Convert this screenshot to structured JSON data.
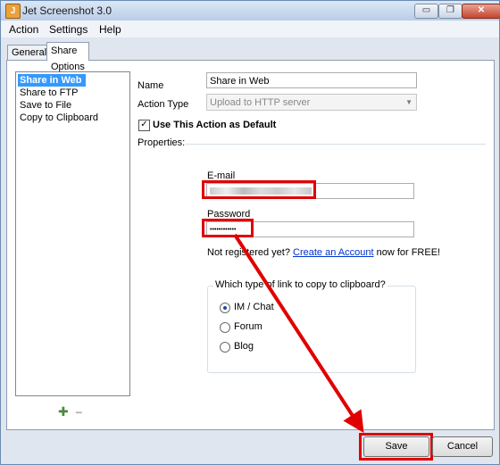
{
  "window": {
    "title": "Jet Screenshot 3.0",
    "minimize_glyph": "▭",
    "restore_glyph": "❐",
    "close_glyph": "✕"
  },
  "menu": {
    "items": [
      {
        "label": "Action"
      },
      {
        "label": "Settings"
      },
      {
        "label": "Help"
      }
    ]
  },
  "tabs": [
    {
      "label": "General"
    },
    {
      "label": "Share Options"
    }
  ],
  "actions": {
    "items": [
      {
        "label": "Share in Web"
      },
      {
        "label": "Share to FTP"
      },
      {
        "label": "Save to File"
      },
      {
        "label": "Copy to Clipboard"
      }
    ],
    "add_glyph": "✚",
    "remove_glyph": "━"
  },
  "form": {
    "name_label": "Name",
    "name_value": "Share in Web",
    "action_type_label": "Action Type",
    "action_type_value": "Upload to HTTP server",
    "use_default_label": "Use This Action as Default",
    "use_default_checked": true,
    "check_glyph": "✓",
    "properties_label": "Properties:"
  },
  "properties": {
    "email_label": "E-mail",
    "password_label": "Password",
    "password_value": "••••••••••••",
    "not_registered_prefix": "Not registered yet?",
    "create_account_link": "Create an Account",
    "not_registered_suffix": "now for FREE!",
    "link_group_title": "Which type of link to copy to clipboard?",
    "link_options": [
      {
        "label": "IM / Chat",
        "selected": true
      },
      {
        "label": "Forum",
        "selected": false
      },
      {
        "label": "Blog",
        "selected": false
      }
    ]
  },
  "footer": {
    "save_label": "Save",
    "cancel_label": "Cancel"
  },
  "colors": {
    "highlight_red": "#e00000",
    "selection_blue": "#3399ff",
    "link_blue": "#0033cc"
  }
}
